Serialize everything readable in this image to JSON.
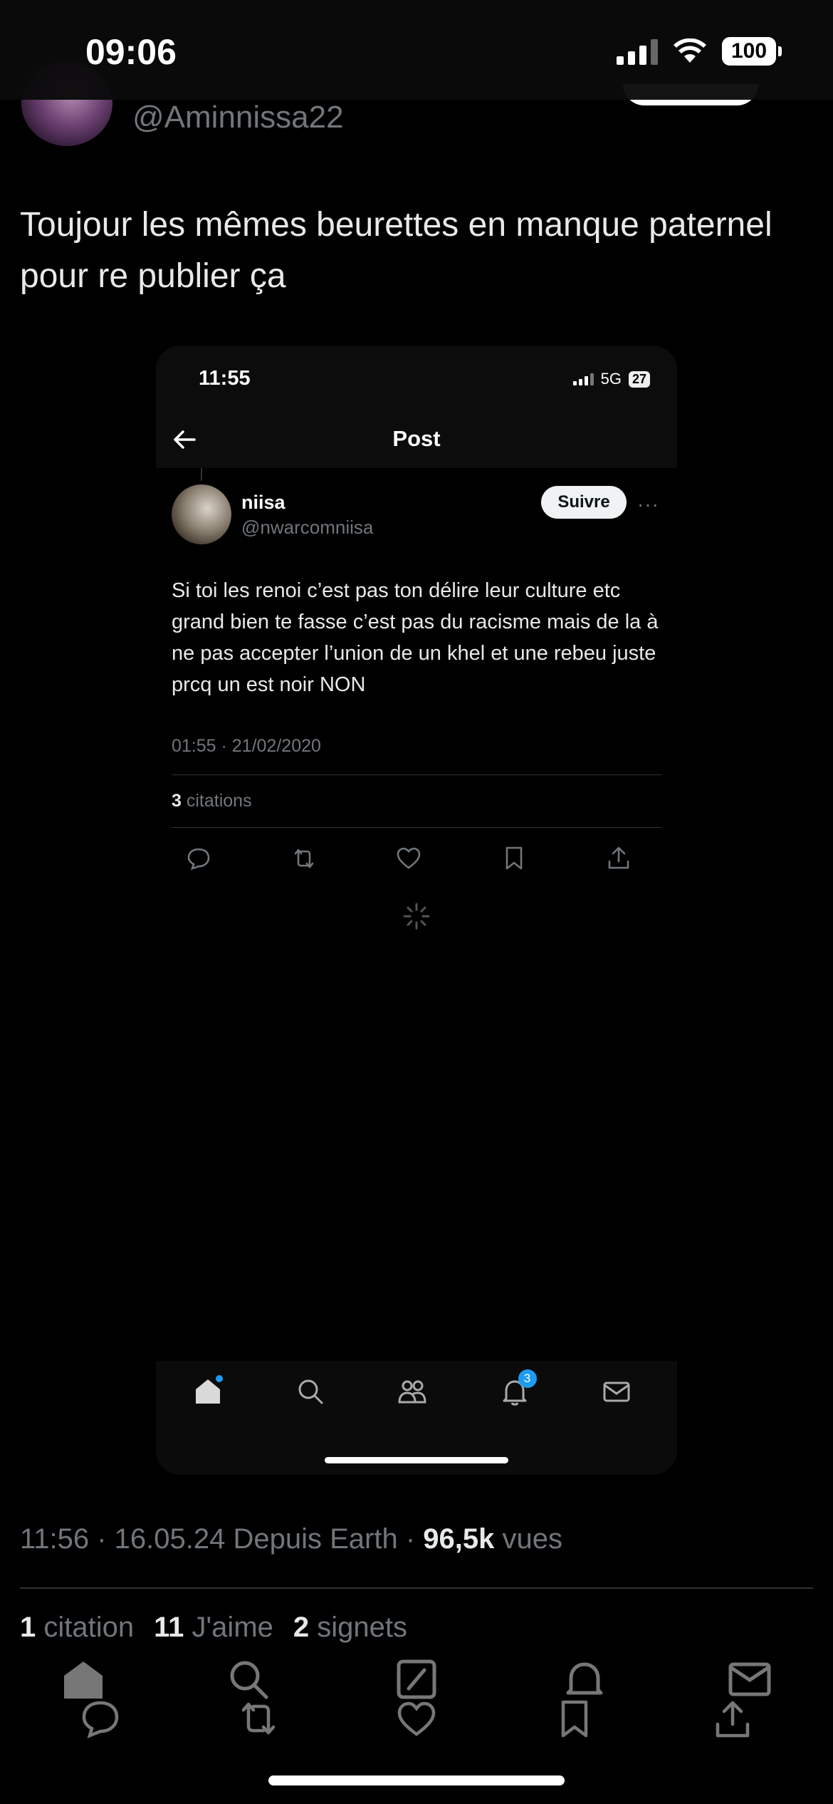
{
  "status_bar": {
    "time": "09:06",
    "battery": "100"
  },
  "author": {
    "handle": "@Aminnissa22"
  },
  "tweet": {
    "text": "Toujour les mêmes beurettes en manque paternel pour re publier ça"
  },
  "embed": {
    "status_time": "11:55",
    "network": "5G",
    "battery": "27",
    "header_title": "Post",
    "user": {
      "name": "niisa",
      "handle": "@nwarcomniisa"
    },
    "follow_label": "Suivre",
    "more": "···",
    "text": "Si toi les renoi c’est pas ton délire leur culture etc grand bien te fasse c’est pas du racisme mais de la à ne pas accepter l’union de un khel et une rebeu juste prcq un est noir NON",
    "date": "01:55 · 21/02/2020",
    "quotes_count": "3",
    "quotes_label": "citations",
    "notif_badge": "3"
  },
  "meta": {
    "time_date_source": "11:56 · 16.05.24 Depuis Earth · ",
    "views_count": "96,5k",
    "views_label": " vues"
  },
  "stats": {
    "quotes_count": "1",
    "quotes_label": "citation",
    "likes_count": "11",
    "likes_label": "J'aime",
    "bookmarks_count": "2",
    "bookmarks_label": "signets"
  },
  "colors": {
    "accent": "#1d9bf0",
    "muted": "#71767b",
    "text": "#e7e9ea",
    "divider": "#2f3336"
  }
}
